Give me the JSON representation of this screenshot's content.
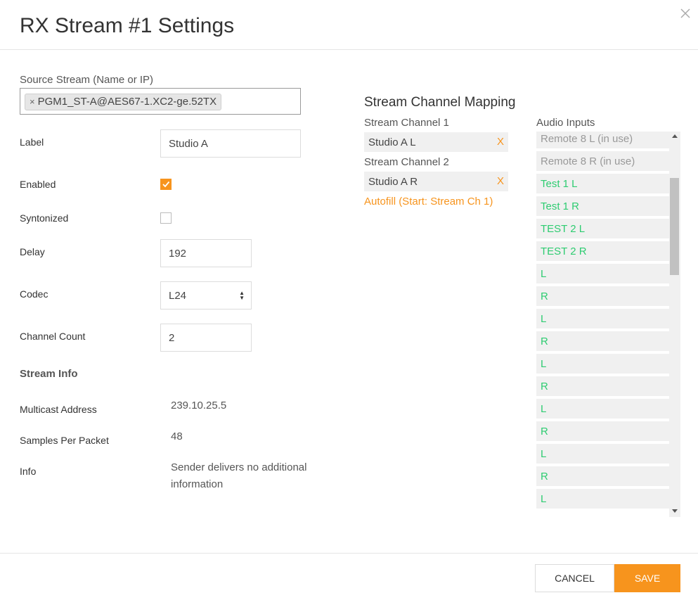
{
  "dialog": {
    "title": "RX Stream #1 Settings"
  },
  "form": {
    "source_stream_label": "Source Stream (Name or IP)",
    "source_stream_chip": "PGM1_ST-A@AES67-1.XC2-ge.52TX",
    "label_label": "Label",
    "label_value": "Studio A",
    "enabled_label": "Enabled",
    "enabled_checked": true,
    "syntonized_label": "Syntonized",
    "syntonized_checked": false,
    "delay_label": "Delay",
    "delay_value": "192",
    "codec_label": "Codec",
    "codec_value": "L24",
    "channel_count_label": "Channel Count",
    "channel_count_value": "2"
  },
  "stream_info": {
    "heading": "Stream Info",
    "multicast_label": "Multicast Address",
    "multicast_value": "239.10.25.5",
    "samples_label": "Samples Per Packet",
    "samples_value": "48",
    "info_label": "Info",
    "info_value_line1": "Sender delivers no additional",
    "info_value_line2": "information"
  },
  "mapping": {
    "title": "Stream Channel Mapping",
    "channels": [
      {
        "label": "Stream Channel 1",
        "value": "Studio A L",
        "remove": "X"
      },
      {
        "label": "Stream Channel 2",
        "value": "Studio A R",
        "remove": "X"
      }
    ],
    "autofill": "Autofill (Start: Stream Ch 1)"
  },
  "audio_inputs": {
    "label": "Audio Inputs",
    "items": [
      {
        "text": "Remote 8 L (in use)",
        "in_use": true
      },
      {
        "text": "Remote 8 R (in use)",
        "in_use": true
      },
      {
        "text": "Test 1 L",
        "in_use": false
      },
      {
        "text": "Test 1 R",
        "in_use": false
      },
      {
        "text": "TEST 2 L",
        "in_use": false
      },
      {
        "text": "TEST 2 R",
        "in_use": false
      },
      {
        "text": "L",
        "in_use": false
      },
      {
        "text": "R",
        "in_use": false
      },
      {
        "text": "L",
        "in_use": false
      },
      {
        "text": "R",
        "in_use": false
      },
      {
        "text": "L",
        "in_use": false
      },
      {
        "text": "R",
        "in_use": false
      },
      {
        "text": "L",
        "in_use": false
      },
      {
        "text": "R",
        "in_use": false
      },
      {
        "text": "L",
        "in_use": false
      },
      {
        "text": "R",
        "in_use": false
      },
      {
        "text": "L",
        "in_use": false
      }
    ]
  },
  "buttons": {
    "cancel": "CANCEL",
    "save": "SAVE"
  },
  "colors": {
    "accent": "#f7941d",
    "available": "#2ecc71",
    "in_use": "#999999"
  }
}
